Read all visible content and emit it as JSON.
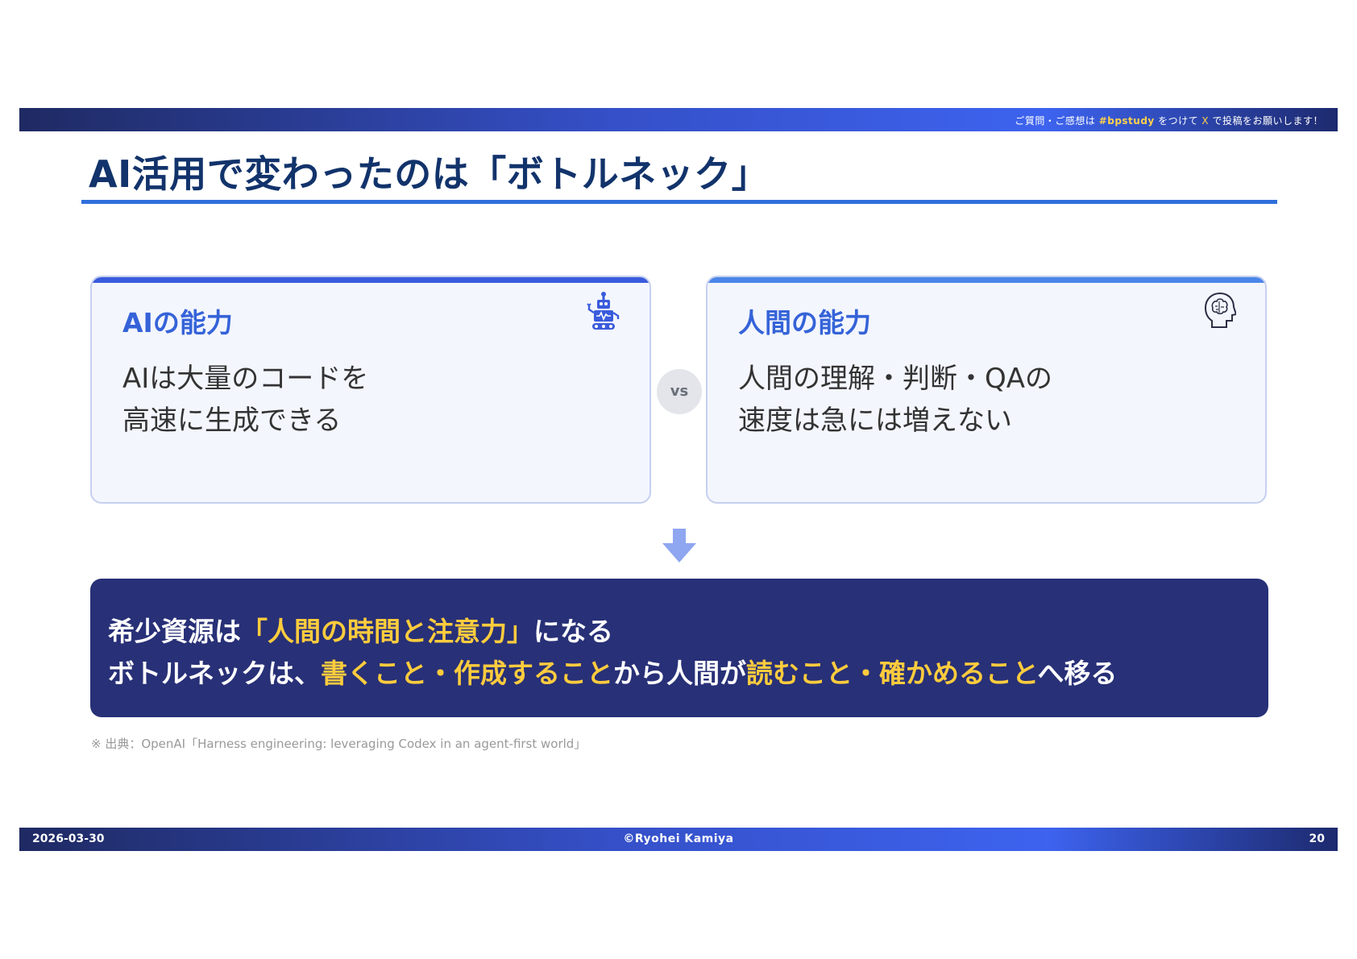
{
  "header": {
    "notice_prefix": "ご質問・ご感想は",
    "hashtag": "#bpstudy",
    "notice_mid": "をつけて",
    "platform": "X",
    "notice_suffix": "で投稿をお願いします！"
  },
  "slide": {
    "title": "AI活用で変わったのは「ボトルネック」"
  },
  "cards": {
    "ai": {
      "title": "AIの能力",
      "line1": "AIは大量のコードを",
      "line2": "高速に生成できる",
      "icon": "robot-icon"
    },
    "human": {
      "title": "人間の能力",
      "line1": "人間の理解・判断・QAの",
      "line2": "速度は急には増えない",
      "icon": "brain-head-icon"
    },
    "vs_label": "vs"
  },
  "conclusion": {
    "line1_a": "希少資源は",
    "line1_b": "「人間の時間と注意力」",
    "line1_c": "になる",
    "line2_a": "ボトルネックは、",
    "line2_b": "書くこと・作成すること",
    "line2_c": "から人間が",
    "line2_d": "読むこと・確かめること",
    "line2_e": "へ移る"
  },
  "source": "※ 出典：OpenAI「Harness engineering: leveraging Codex in an agent-first world」",
  "footer": {
    "date": "2026-03-30",
    "copyright": "©Ryohei Kamiya",
    "page_number": "20"
  },
  "colors": {
    "title": "#12336b",
    "accent_blue": "#3563d8",
    "banner_bg": "#283077",
    "highlight_yellow": "#ffcc3d"
  }
}
